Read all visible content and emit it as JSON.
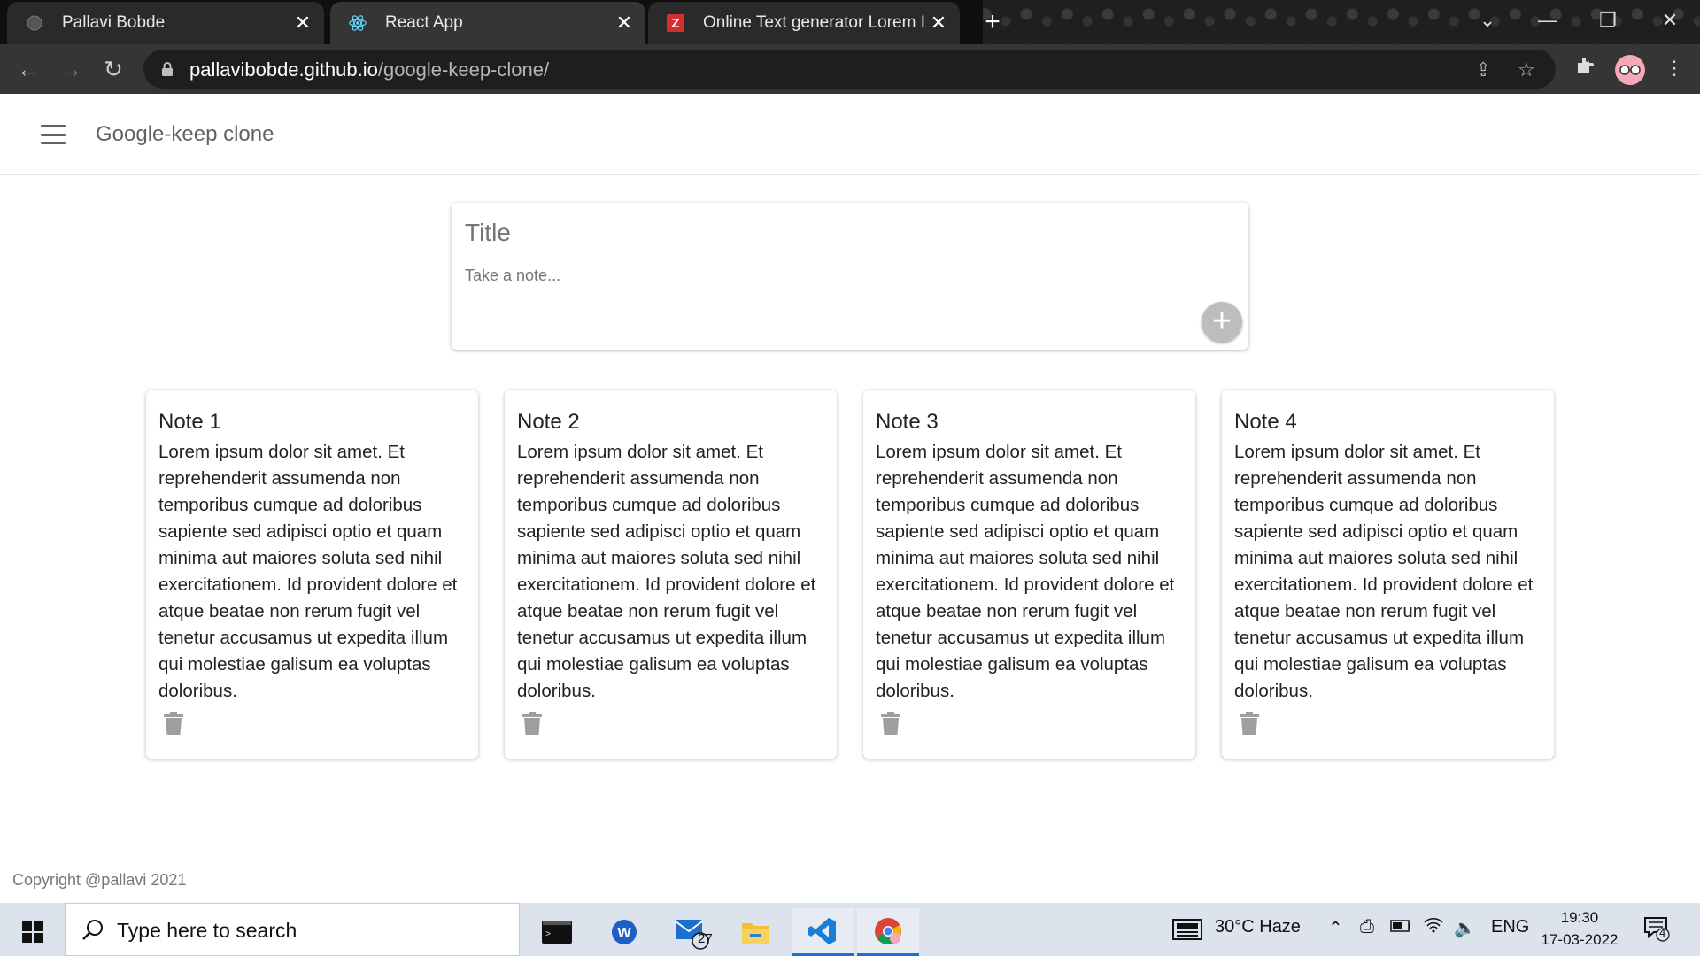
{
  "browser": {
    "tabs": [
      {
        "title": "Pallavi Bobde",
        "icon": "globe-icon",
        "state": "inactive"
      },
      {
        "title": "React App",
        "icon": "react-icon",
        "state": "active"
      },
      {
        "title": "Online Text generator Lorem Ipsu",
        "icon": "z-logo-icon",
        "state": "inactive"
      }
    ],
    "url_host": "pallavibobde.github.io",
    "url_path": "/google-keep-clone/"
  },
  "app": {
    "title": "Google-keep clone",
    "create": {
      "title_placeholder": "Title",
      "note_placeholder": "Take a note..."
    },
    "notes": [
      {
        "title": "Note 1",
        "content": "Lorem ipsum dolor sit amet. Et reprehenderit assumenda non temporibus cumque ad doloribus sapiente sed adipisci optio et quam minima aut maiores soluta sed nihil exercitationem. Id provident dolore et atque beatae non rerum fugit vel tenetur accusamus ut expedita illum qui molestiae galisum ea voluptas doloribus."
      },
      {
        "title": "Note 2",
        "content": "Lorem ipsum dolor sit amet. Et reprehenderit assumenda non temporibus cumque ad doloribus sapiente sed adipisci optio et quam minima aut maiores soluta sed nihil exercitationem. Id provident dolore et atque beatae non rerum fugit vel tenetur accusamus ut expedita illum qui molestiae galisum ea voluptas doloribus."
      },
      {
        "title": "Note 3",
        "content": "Lorem ipsum dolor sit amet. Et reprehenderit assumenda non temporibus cumque ad doloribus sapiente sed adipisci optio et quam minima aut maiores soluta sed nihil exercitationem. Id provident dolore et atque beatae non rerum fugit vel tenetur accusamus ut expedita illum qui molestiae galisum ea voluptas doloribus."
      },
      {
        "title": "Note 4",
        "content": "Lorem ipsum dolor sit amet. Et reprehenderit assumenda non temporibus cumque ad doloribus sapiente sed adipisci optio et quam minima aut maiores soluta sed nihil exercitationem. Id provident dolore et atque beatae non rerum fugit vel tenetur accusamus ut expedita illum qui molestiae galisum ea voluptas doloribus."
      }
    ],
    "footer": "Copyright @pallavi 2021"
  },
  "taskbar": {
    "search_placeholder": "Type here to search",
    "mail_badge": "27",
    "weather": "30°C  Haze",
    "language": "ENG",
    "time": "19:30",
    "date": "17-03-2022",
    "notification_count": "4"
  },
  "colors": {
    "accent": "#1a6fd0",
    "plus_button": "#bdbdbd",
    "icon_gray": "#9e9e9e"
  }
}
